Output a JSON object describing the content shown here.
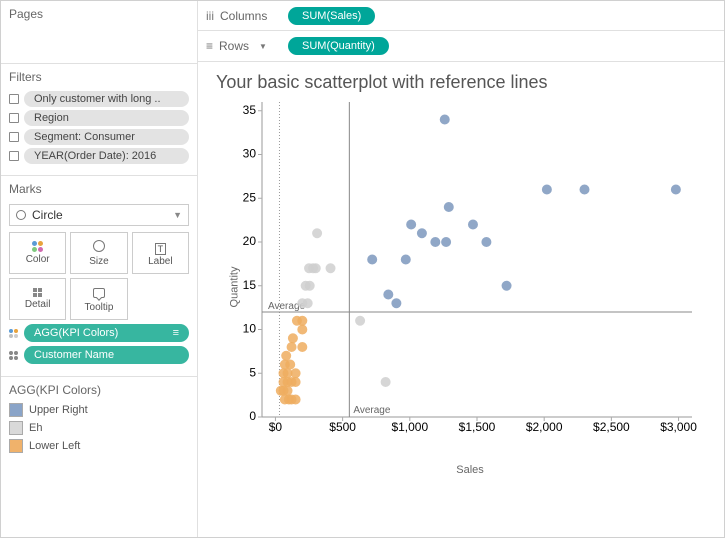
{
  "panels": {
    "pages_title": "Pages",
    "filters_title": "Filters",
    "marks_title": "Marks",
    "legend_title": "AGG(KPI Colors)"
  },
  "filters": [
    "Only customer with long ..",
    "Region",
    "Segment: Consumer",
    "YEAR(Order Date): 2016"
  ],
  "marks": {
    "type": "Circle",
    "buttons": [
      "Color",
      "Size",
      "Label",
      "Detail",
      "Tooltip"
    ],
    "shelf_pills": [
      {
        "label": "AGG(KPI Colors)",
        "glyph": "≡",
        "dots": [
          "#5b9bd5",
          "#e8a33d",
          "#bfbfbf",
          "#ccc"
        ]
      },
      {
        "label": "Customer Name",
        "glyph": "",
        "dots": [
          "#888",
          "#888",
          "#888",
          "#888"
        ]
      }
    ]
  },
  "legend": [
    {
      "label": "Upper Right",
      "color": "#8aa4c8"
    },
    {
      "label": "Eh",
      "color": "#d9d9d9"
    },
    {
      "label": "Lower Left",
      "color": "#f0b26b"
    }
  ],
  "shelves": {
    "columns_label": "Columns",
    "rows_label": "Rows",
    "columns_pill": "SUM(Sales)",
    "rows_pill": "SUM(Quantity)"
  },
  "viz": {
    "title": "Your basic scatterplot with reference lines",
    "xlabel": "Sales",
    "ylabel": "Quantity",
    "ref_label": "Average"
  },
  "chart_data": {
    "type": "scatter",
    "xlabel": "Sales",
    "ylabel": "Quantity",
    "xlim": [
      -100,
      3100
    ],
    "ylim": [
      0,
      36
    ],
    "x_ticks": [
      0,
      500,
      1000,
      1500,
      2000,
      2500,
      3000
    ],
    "x_tick_labels": [
      "$0",
      "$500",
      "$1,000",
      "$1,500",
      "$2,000",
      "$2,500",
      "$3,000"
    ],
    "y_ticks": [
      0,
      5,
      10,
      15,
      20,
      25,
      30,
      35
    ],
    "ref_x": 550,
    "ref_y": 12,
    "ref_dashed_x": 30,
    "colors": {
      "Upper Right": "#7d98bd",
      "Eh": "#cfcfcf",
      "Lower Left": "#eead5f"
    },
    "series": [
      {
        "name": "Upper Right",
        "points": [
          [
            720,
            18
          ],
          [
            840,
            14
          ],
          [
            900,
            13
          ],
          [
            970,
            18
          ],
          [
            1010,
            22
          ],
          [
            1090,
            21
          ],
          [
            1190,
            20
          ],
          [
            1260,
            34
          ],
          [
            1270,
            20
          ],
          [
            1290,
            24
          ],
          [
            1470,
            22
          ],
          [
            1570,
            20
          ],
          [
            1720,
            15
          ],
          [
            2020,
            26
          ],
          [
            2300,
            26
          ],
          [
            2980,
            26
          ]
        ]
      },
      {
        "name": "Eh",
        "points": [
          [
            250,
            17
          ],
          [
            280,
            17
          ],
          [
            300,
            17
          ],
          [
            310,
            21
          ],
          [
            410,
            17
          ],
          [
            225,
            15
          ],
          [
            255,
            15
          ],
          [
            200,
            13
          ],
          [
            240,
            13
          ],
          [
            630,
            11
          ],
          [
            820,
            4
          ]
        ]
      },
      {
        "name": "Lower Left",
        "points": [
          [
            40,
            3
          ],
          [
            60,
            3
          ],
          [
            90,
            3
          ],
          [
            70,
            2
          ],
          [
            100,
            2
          ],
          [
            120,
            2
          ],
          [
            150,
            2
          ],
          [
            60,
            4
          ],
          [
            90,
            4
          ],
          [
            120,
            4
          ],
          [
            150,
            4
          ],
          [
            60,
            5
          ],
          [
            90,
            5
          ],
          [
            150,
            5
          ],
          [
            70,
            6
          ],
          [
            110,
            6
          ],
          [
            80,
            7
          ],
          [
            120,
            8
          ],
          [
            200,
            8
          ],
          [
            130,
            9
          ],
          [
            200,
            10
          ],
          [
            160,
            11
          ],
          [
            200,
            11
          ]
        ]
      }
    ]
  }
}
